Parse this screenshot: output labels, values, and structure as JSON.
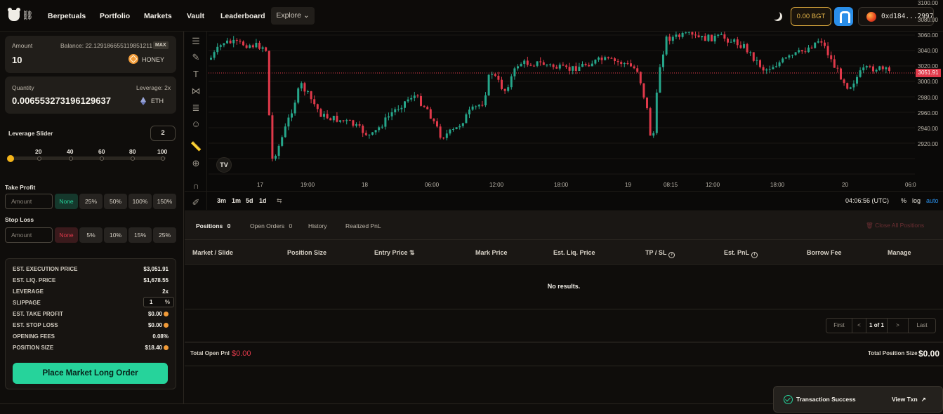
{
  "nav": {
    "links": [
      "Berpetuals",
      "Portfolio",
      "Markets",
      "Vault",
      "Leaderboard"
    ],
    "explore": "Explore ⌄",
    "bgt": "0.00 BGT",
    "wallet": "0xd184...2997"
  },
  "order": {
    "amount_label": "Amount",
    "balance": "Balance: 22.129186655119851211",
    "max": "MAX",
    "amount_value": "10",
    "amount_token": "HONEY",
    "quantity_label": "Quantity",
    "leverage_label": "Leverage: 2x",
    "quantity_value": "0.006553273196129637",
    "quantity_token": "ETH",
    "slider_label": "Leverage Slider",
    "leverage_value": "2",
    "slider_ticks": [
      "20",
      "40",
      "60",
      "80",
      "100"
    ],
    "slider_level": 2,
    "take_profit_label": "Take Profit",
    "tp_placeholder": "Amount",
    "tp_options": [
      "None",
      "25%",
      "50%",
      "100%",
      "150%"
    ],
    "stop_loss_label": "Stop Loss",
    "sl_placeholder": "Amount",
    "sl_options": [
      "None",
      "5%",
      "10%",
      "15%",
      "25%"
    ],
    "summary": [
      {
        "label": "EST. EXECUTION PRICE",
        "value": "$3,051.91"
      },
      {
        "label": "EST. LIQ. PRICE",
        "value": "$1,678.55"
      },
      {
        "label": "LEVERAGE",
        "value": "2x"
      },
      {
        "label": "SLIPPAGE",
        "value": "1"
      },
      {
        "label": "EST. TAKE PROFIT",
        "value": "$0.00"
      },
      {
        "label": "EST. STOP LOSS",
        "value": "$0.00"
      },
      {
        "label": "OPENING FEES",
        "value": "0.08%"
      },
      {
        "label": "POSITION SIZE",
        "value": "$18.40"
      }
    ],
    "slippage_unit": "%",
    "place_button": "Place Market Long Order"
  },
  "chart": {
    "y_ticks": [
      "3100.00",
      "3080.00",
      "3060.00",
      "3040.00",
      "3020.00",
      "3000.00",
      "2980.00",
      "2960.00",
      "2940.00",
      "2920.00"
    ],
    "current_price": "3051.91",
    "x_ticks": [
      "17",
      "19:00",
      "18",
      "06:00",
      "12:00",
      "18:00",
      "19",
      "08:15",
      "12:00",
      "18:00",
      "20",
      "06:0"
    ],
    "timeframes": [
      "3m",
      "1m",
      "5d",
      "1d"
    ],
    "clock": "04:06:56 (UTC)",
    "scale_opts": [
      "%",
      "log",
      "auto"
    ],
    "up_color": "#26a68a",
    "down_color": "#e0394a"
  },
  "positions": {
    "tabs": [
      "Positions",
      "Open Orders",
      "History",
      "Realized PnL"
    ],
    "positions_count": "0",
    "open_orders_count": "0",
    "close_all": "Close All Positions",
    "columns": [
      "Market / Slide",
      "Position Size",
      "Entry Price",
      "Mark Price",
      "Est. Liq. Price",
      "TP / SL",
      "Est. PnL",
      "Borrow Fee",
      "Manage"
    ],
    "empty": "No results.",
    "pager": {
      "first": "First",
      "prev": "<",
      "page": "1 of 1",
      "next": ">",
      "last": "Last"
    },
    "total_open_label": "Total Open Pnl",
    "total_open_value": "$0.00",
    "total_pos_label": "Total Position Size",
    "total_pos_value": "$0.00"
  },
  "toast": {
    "title": "Transaction Success",
    "action": "View Txn"
  }
}
